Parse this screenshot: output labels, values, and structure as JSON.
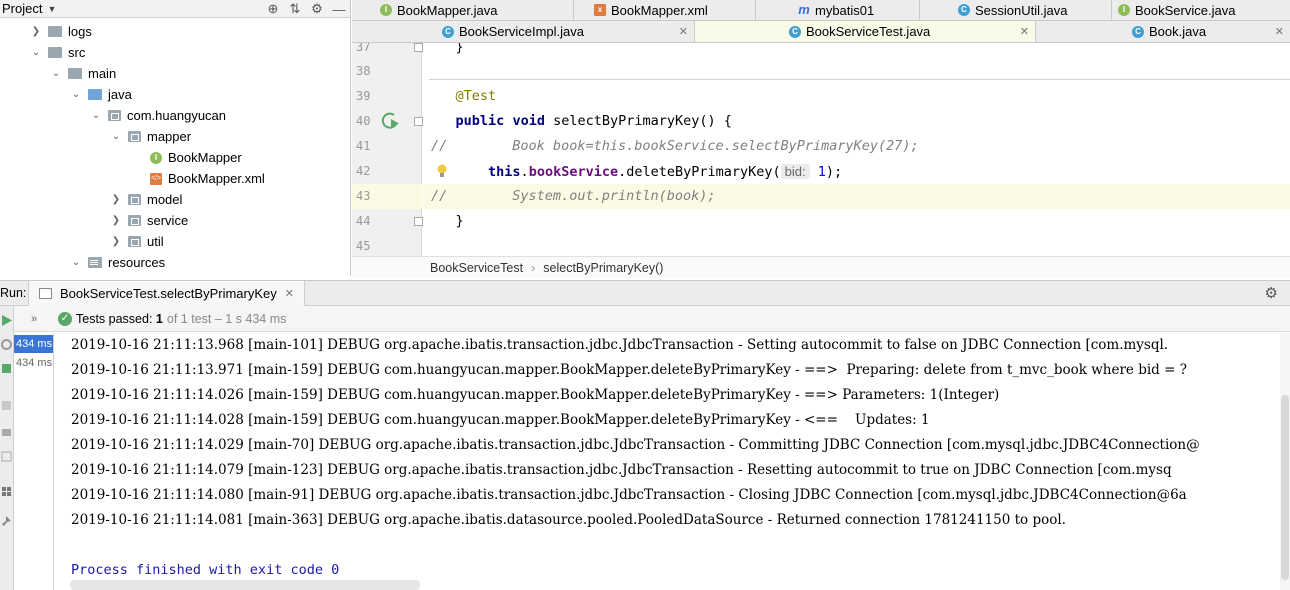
{
  "project": {
    "title": "Project",
    "tree": [
      {
        "label": "logs"
      },
      {
        "label": "src"
      },
      {
        "label": "main"
      },
      {
        "label": "java"
      },
      {
        "label": "com.huangyucan"
      },
      {
        "label": "mapper"
      },
      {
        "label": "BookMapper"
      },
      {
        "label": "BookMapper.xml"
      },
      {
        "label": "model"
      },
      {
        "label": "service"
      },
      {
        "label": "util"
      },
      {
        "label": "resources"
      }
    ]
  },
  "tabs_row1": [
    {
      "label": "BookMapper.java"
    },
    {
      "label": "BookMapper.xml"
    },
    {
      "label": "mybatis01"
    },
    {
      "label": "SessionUtil.java"
    },
    {
      "label": "BookService.java"
    }
  ],
  "tabs_row2": [
    {
      "label": "BookServiceImpl.java"
    },
    {
      "label": "BookServiceTest.java"
    },
    {
      "label": "Book.java"
    }
  ],
  "editor": {
    "line_numbers": [
      "37",
      "38",
      "39",
      "40",
      "41",
      "42",
      "43",
      "44",
      "45"
    ],
    "line37": "}",
    "annotation": "@Test",
    "kw_public": "public",
    "kw_void": "void",
    "method_sig": " selectByPrimaryKey() {",
    "comment_marker": "//",
    "line41_comment": "Book book=this.bookService.selectByPrimaryKey(27);",
    "kw_this": "this",
    "field_name": "bookService",
    "call": ".deleteByPrimaryKey(",
    "param_hint": "bid:",
    "arg_value": "1",
    "call_end": ");",
    "line43_comment": "System.out.println(book);",
    "line44": "}"
  },
  "breadcrumb": {
    "class_name": "BookServiceTest",
    "method_name": "selectByPrimaryKey()"
  },
  "run": {
    "label": "Run:",
    "tab_title": "BookServiceTest.selectByPrimaryKey",
    "status_prefix": "Tests passed:",
    "status_count": "1",
    "status_detail": "of 1 test – 1 s 434 ms",
    "durations": [
      "434 ms",
      "434 ms"
    ],
    "console_lines": [
      "2019-10-16 21:11:13.968 [main-101] DEBUG org.apache.ibatis.transaction.jdbc.JdbcTransaction - Setting autocommit to false on JDBC Connection [com.mysql.",
      "2019-10-16 21:11:13.971 [main-159] DEBUG com.huangyucan.mapper.BookMapper.deleteByPrimaryKey - ==>  Preparing: delete from t_mvc_book where bid = ?",
      "2019-10-16 21:11:14.026 [main-159] DEBUG com.huangyucan.mapper.BookMapper.deleteByPrimaryKey - ==> Parameters: 1(Integer)",
      "2019-10-16 21:11:14.028 [main-159] DEBUG com.huangyucan.mapper.BookMapper.deleteByPrimaryKey - <==    Updates: 1",
      "2019-10-16 21:11:14.029 [main-70] DEBUG org.apache.ibatis.transaction.jdbc.JdbcTransaction - Committing JDBC Connection [com.mysql.jdbc.JDBC4Connection@",
      "2019-10-16 21:11:14.079 [main-123] DEBUG org.apache.ibatis.transaction.jdbc.JdbcTransaction - Resetting autocommit to true on JDBC Connection [com.mysq",
      "2019-10-16 21:11:14.080 [main-91] DEBUG org.apache.ibatis.transaction.jdbc.JdbcTransaction - Closing JDBC Connection [com.mysql.jdbc.JDBC4Connection@6a",
      "2019-10-16 21:11:14.081 [main-363] DEBUG org.apache.ibatis.datasource.pooled.PooledDataSource - Returned connection 1781241150 to pool."
    ],
    "process_finished": "Process finished with exit code 0"
  }
}
